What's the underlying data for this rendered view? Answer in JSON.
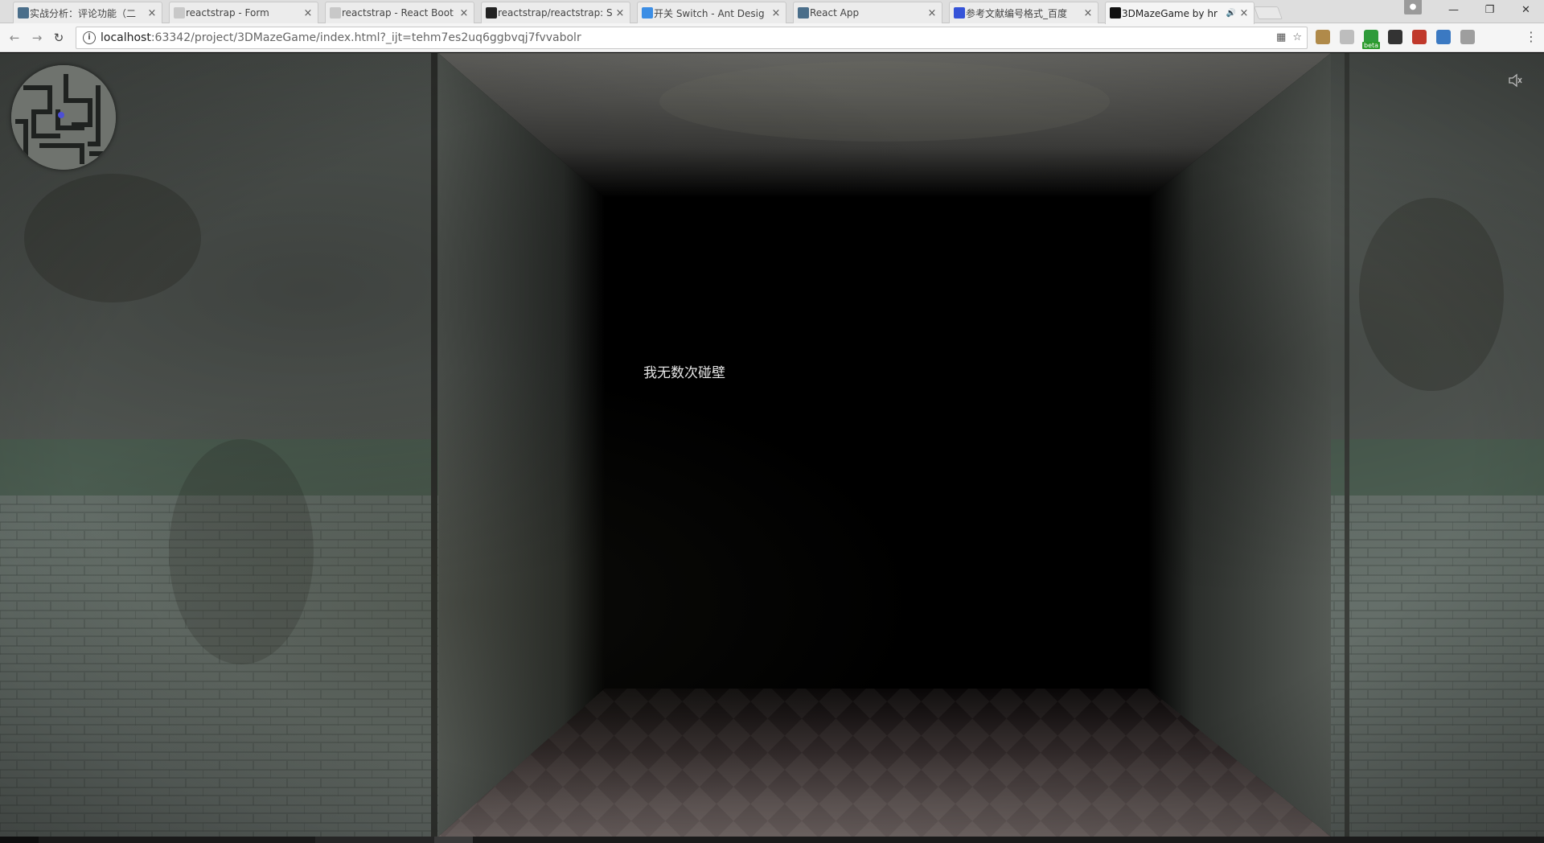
{
  "browser": {
    "tabs": [
      {
        "title": "实战分析：评论功能（二",
        "favicon": "react-app-icon",
        "favicon_color": "#4a6e8a",
        "active": false
      },
      {
        "title": "reactstrap - Form",
        "favicon": "reactstrap-icon",
        "favicon_color": "#c8c8c8",
        "active": false
      },
      {
        "title": "reactstrap - React Boot",
        "favicon": "reactstrap-icon",
        "favicon_color": "#c8c8c8",
        "active": false
      },
      {
        "title": "reactstrap/reactstrap: S",
        "favicon": "github-icon",
        "favicon_color": "#222222",
        "active": false
      },
      {
        "title": "开关 Switch - Ant Desig",
        "favicon": "ant-design-icon",
        "favicon_color": "#3c8ee5",
        "active": false
      },
      {
        "title": "React App",
        "favicon": "react-app-icon",
        "favicon_color": "#4a6e8a",
        "active": false
      },
      {
        "title": "参考文献编号格式_百度",
        "favicon": "baidu-icon",
        "favicon_color": "#3553d8",
        "active": false
      },
      {
        "title": "3DMazeGame by hr",
        "favicon": "webstorm-icon",
        "favicon_color": "#111111",
        "active": true,
        "audio": true
      }
    ],
    "url": {
      "host": "localhost",
      "rest": ":63342/project/3DMazeGame/index.html?_ijt=tehm7es2uq6ggbvqj7fvvabolr"
    },
    "window_controls": {
      "minimize": "—",
      "restore": "❐",
      "close": "✕"
    },
    "extensions": [
      {
        "name": "extension-icon-1",
        "color": "#b08a4a"
      },
      {
        "name": "extension-icon-2",
        "color": "#bdbdbd"
      },
      {
        "name": "extension-icon-3",
        "color": "#2f9b3a",
        "badge": "beta"
      },
      {
        "name": "calculator-icon",
        "color": "#333333"
      },
      {
        "name": "extension-icon-5",
        "color": "#c0392b"
      },
      {
        "name": "extension-icon-6",
        "color": "#3b79c2"
      },
      {
        "name": "extension-icon-7",
        "color": "#9e9e9e"
      }
    ]
  },
  "game": {
    "message": "我无数次碰壁",
    "sound": "muted",
    "colors": {
      "wall": "#5d6359",
      "wall_lower": "#6f7a73",
      "ceiling": "#5a5a56",
      "floor_dark": "#3a2f2f",
      "floor_light": "#8b8583",
      "void": "#000000"
    }
  }
}
